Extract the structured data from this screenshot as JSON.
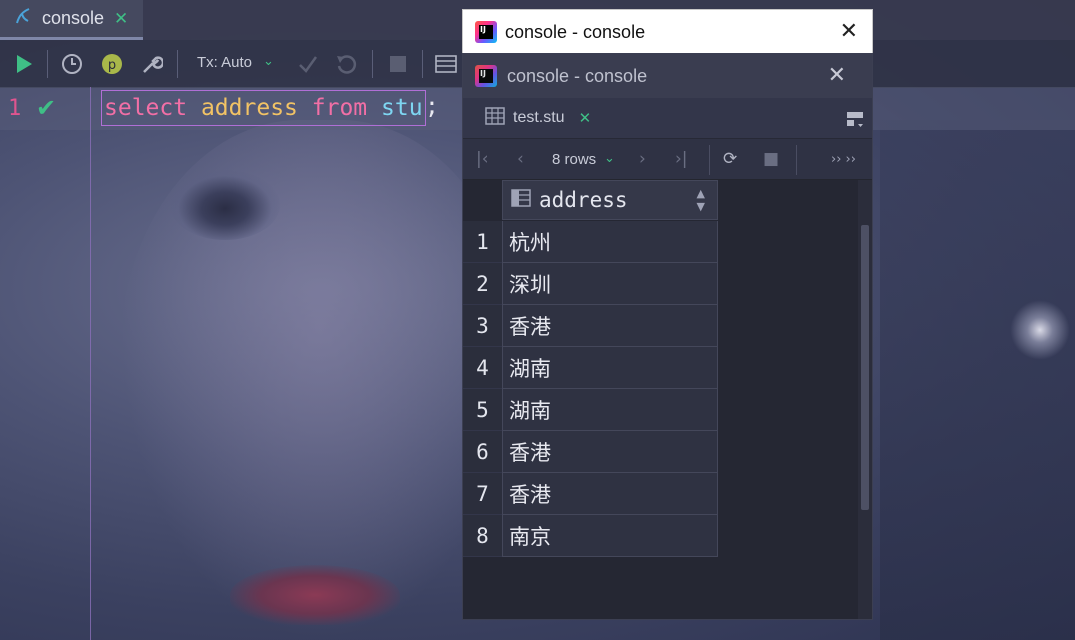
{
  "editor": {
    "tab": {
      "label": "console",
      "icon": "database-icon"
    },
    "toolbar": {
      "tx_label": "Tx: Auto",
      "buttons": [
        "run-icon",
        "history-icon",
        "profile-icon",
        "wrench-icon",
        "commit-icon",
        "rollback-icon",
        "stop-icon",
        "table-icon"
      ]
    },
    "line_number": "1",
    "code": {
      "kw1": "select",
      "col": "address",
      "kw2": "from",
      "table": "stu",
      "semi": ";"
    }
  },
  "popup": {
    "title": "console - console",
    "inner_title": "console - console",
    "result_tab": "test.stu",
    "rows_label": "8 rows",
    "column": "address",
    "rows": [
      {
        "n": "1",
        "address": "杭州"
      },
      {
        "n": "2",
        "address": "深圳"
      },
      {
        "n": "3",
        "address": "香港"
      },
      {
        "n": "4",
        "address": "湖南"
      },
      {
        "n": "5",
        "address": "湖南"
      },
      {
        "n": "6",
        "address": "香港"
      },
      {
        "n": "7",
        "address": "香港"
      },
      {
        "n": "8",
        "address": "南京"
      }
    ]
  },
  "colors": {
    "accent_green": "#3fbf86",
    "keyword": "#f26fa6",
    "identifier": "#f2c365",
    "table": "#7ed6f2"
  }
}
